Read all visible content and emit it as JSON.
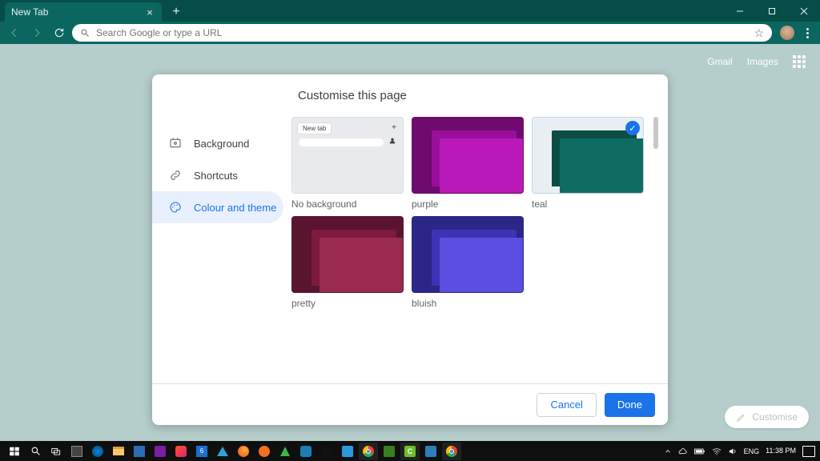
{
  "titlebar": {
    "tab_title": "New Tab"
  },
  "toolbar": {
    "omnibox_placeholder": "Search Google or type a URL"
  },
  "page": {
    "gmail": "Gmail",
    "images": "Images",
    "customise_pill": "Customise"
  },
  "dialog": {
    "title": "Customise this page",
    "nav": {
      "background": "Background",
      "shortcuts": "Shortcuts",
      "colour": "Colour and theme"
    },
    "mini_tab": "New tab",
    "themes": [
      {
        "id": "no-background",
        "label": "No background",
        "selected": false,
        "top": null,
        "bot": null
      },
      {
        "id": "purple",
        "label": "purple",
        "selected": false,
        "top": "#9a0f9a",
        "bot": "#b819b8",
        "bg": "#6f0b6f"
      },
      {
        "id": "teal",
        "label": "teal",
        "selected": true,
        "top": "#0b4d45",
        "bot": "#0e6d62",
        "bg": "#0a3d37"
      },
      {
        "id": "pretty",
        "label": "pretty",
        "selected": false,
        "top": "#7d1a3e",
        "bot": "#9b2a50",
        "bg": "#5a1430"
      },
      {
        "id": "bluish",
        "label": "bluish",
        "selected": false,
        "top": "#3b34b5",
        "bot": "#5b4fe0",
        "bg": "#2c2689"
      }
    ],
    "cancel": "Cancel",
    "done": "Done"
  },
  "tray": {
    "lang": "ENG",
    "time": "11:38 PM"
  }
}
